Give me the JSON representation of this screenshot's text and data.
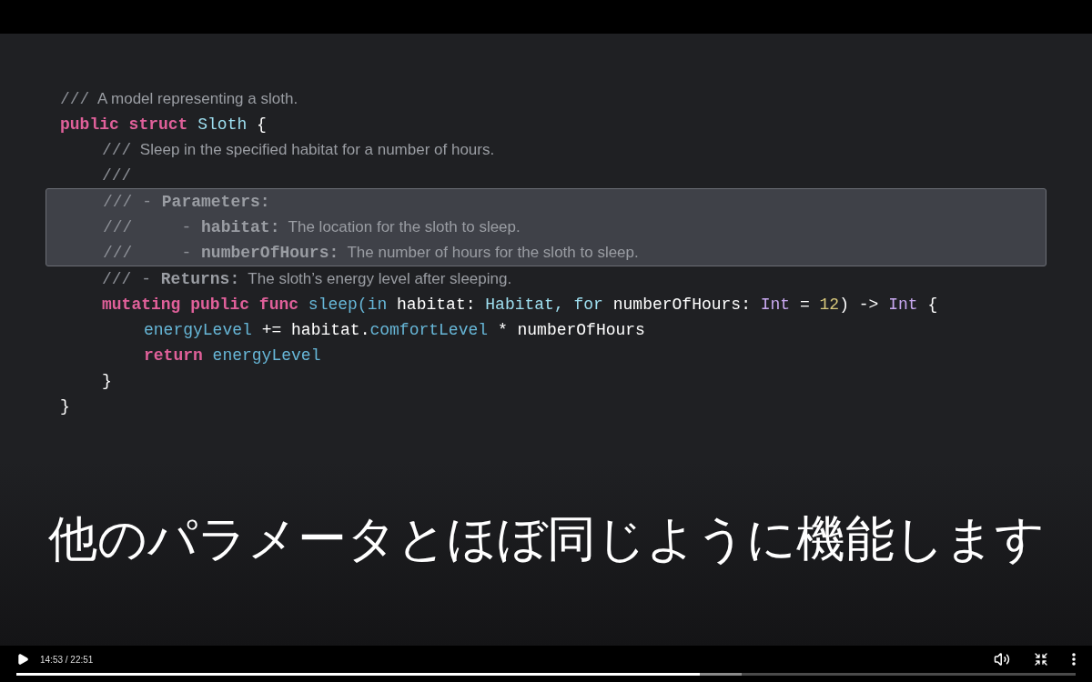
{
  "code_lines": [
    {
      "tokens": [
        {
          "text": "///",
          "kind": "slashes"
        },
        {
          "text": "  A model representing a sloth.",
          "kind": "doc"
        }
      ]
    },
    {
      "tokens": [
        {
          "text": "public struct",
          "kind": "keyword"
        },
        {
          "text": " Sloth",
          "kind": "type"
        },
        {
          "text": " {",
          "kind": "plain"
        }
      ],
      "children": [
        {
          "tokens": [
            {
              "text": "///",
              "kind": "slashes"
            },
            {
              "text": "  Sleep in the specified habitat for a number of hours.",
              "kind": "doc"
            }
          ]
        },
        {
          "tokens": [
            {
              "text": "///",
              "kind": "slashes"
            }
          ]
        },
        {
          "highlighted": true,
          "tokens": [
            {
              "text": "/// - ",
              "kind": "slashes"
            },
            {
              "text": "Parameters:",
              "kind": "doc-key"
            }
          ]
        },
        {
          "highlighted": true,
          "tokens": [
            {
              "text": "///     - ",
              "kind": "slashes"
            },
            {
              "text": "habitat:",
              "kind": "doc-key"
            },
            {
              "text": "  The location for the sloth to sleep.",
              "kind": "doc"
            }
          ]
        },
        {
          "highlighted": true,
          "tokens": [
            {
              "text": "///     - ",
              "kind": "slashes"
            },
            {
              "text": "numberOfHours:",
              "kind": "doc-key"
            },
            {
              "text": "  The number of hours for the sloth to sleep.",
              "kind": "doc"
            }
          ]
        },
        {
          "tokens": [
            {
              "text": "/// - ",
              "kind": "slashes"
            },
            {
              "text": "Returns:",
              "kind": "doc-key"
            },
            {
              "text": "  The sloth’s energy level after sleeping.",
              "kind": "doc"
            }
          ]
        },
        {
          "tokens": [
            {
              "text": "mutating public func",
              "kind": "keyword"
            },
            {
              "text": " sleep(in",
              "kind": "identifier"
            },
            {
              "text": " habitat: ",
              "kind": "plain"
            },
            {
              "text": "Habitat, for",
              "kind": "type"
            },
            {
              "text": " numberOfHours: ",
              "kind": "plain"
            },
            {
              "text": "Int",
              "kind": "system-type"
            },
            {
              "text": " = ",
              "kind": "plain"
            },
            {
              "text": "12",
              "kind": "number"
            },
            {
              "text": ") -> ",
              "kind": "plain"
            },
            {
              "text": "Int",
              "kind": "system-type"
            },
            {
              "text": " {",
              "kind": "plain"
            }
          ],
          "children": [
            {
              "tokens": [
                {
                  "text": "energyLevel",
                  "kind": "identifier"
                },
                {
                  "text": " += habitat.",
                  "kind": "plain"
                },
                {
                  "text": "comfortLevel",
                  "kind": "identifier"
                },
                {
                  "text": " * numberOfHours",
                  "kind": "plain"
                }
              ]
            },
            {
              "tokens": [
                {
                  "text": "return",
                  "kind": "keyword"
                },
                {
                  "text": " energyLevel",
                  "kind": "identifier"
                }
              ]
            }
          ]
        },
        {
          "tokens": [
            {
              "text": "}",
              "kind": "plain"
            }
          ]
        }
      ]
    },
    {
      "tokens": [
        {
          "text": "}",
          "kind": "plain"
        }
      ]
    }
  ],
  "subtitle": "他のパラメータとほぼ同じように機能します",
  "player": {
    "time": "14:53 / 22:51",
    "progress": {
      "level": 0.645
    },
    "buffered": {
      "level": 0.685
    }
  }
}
